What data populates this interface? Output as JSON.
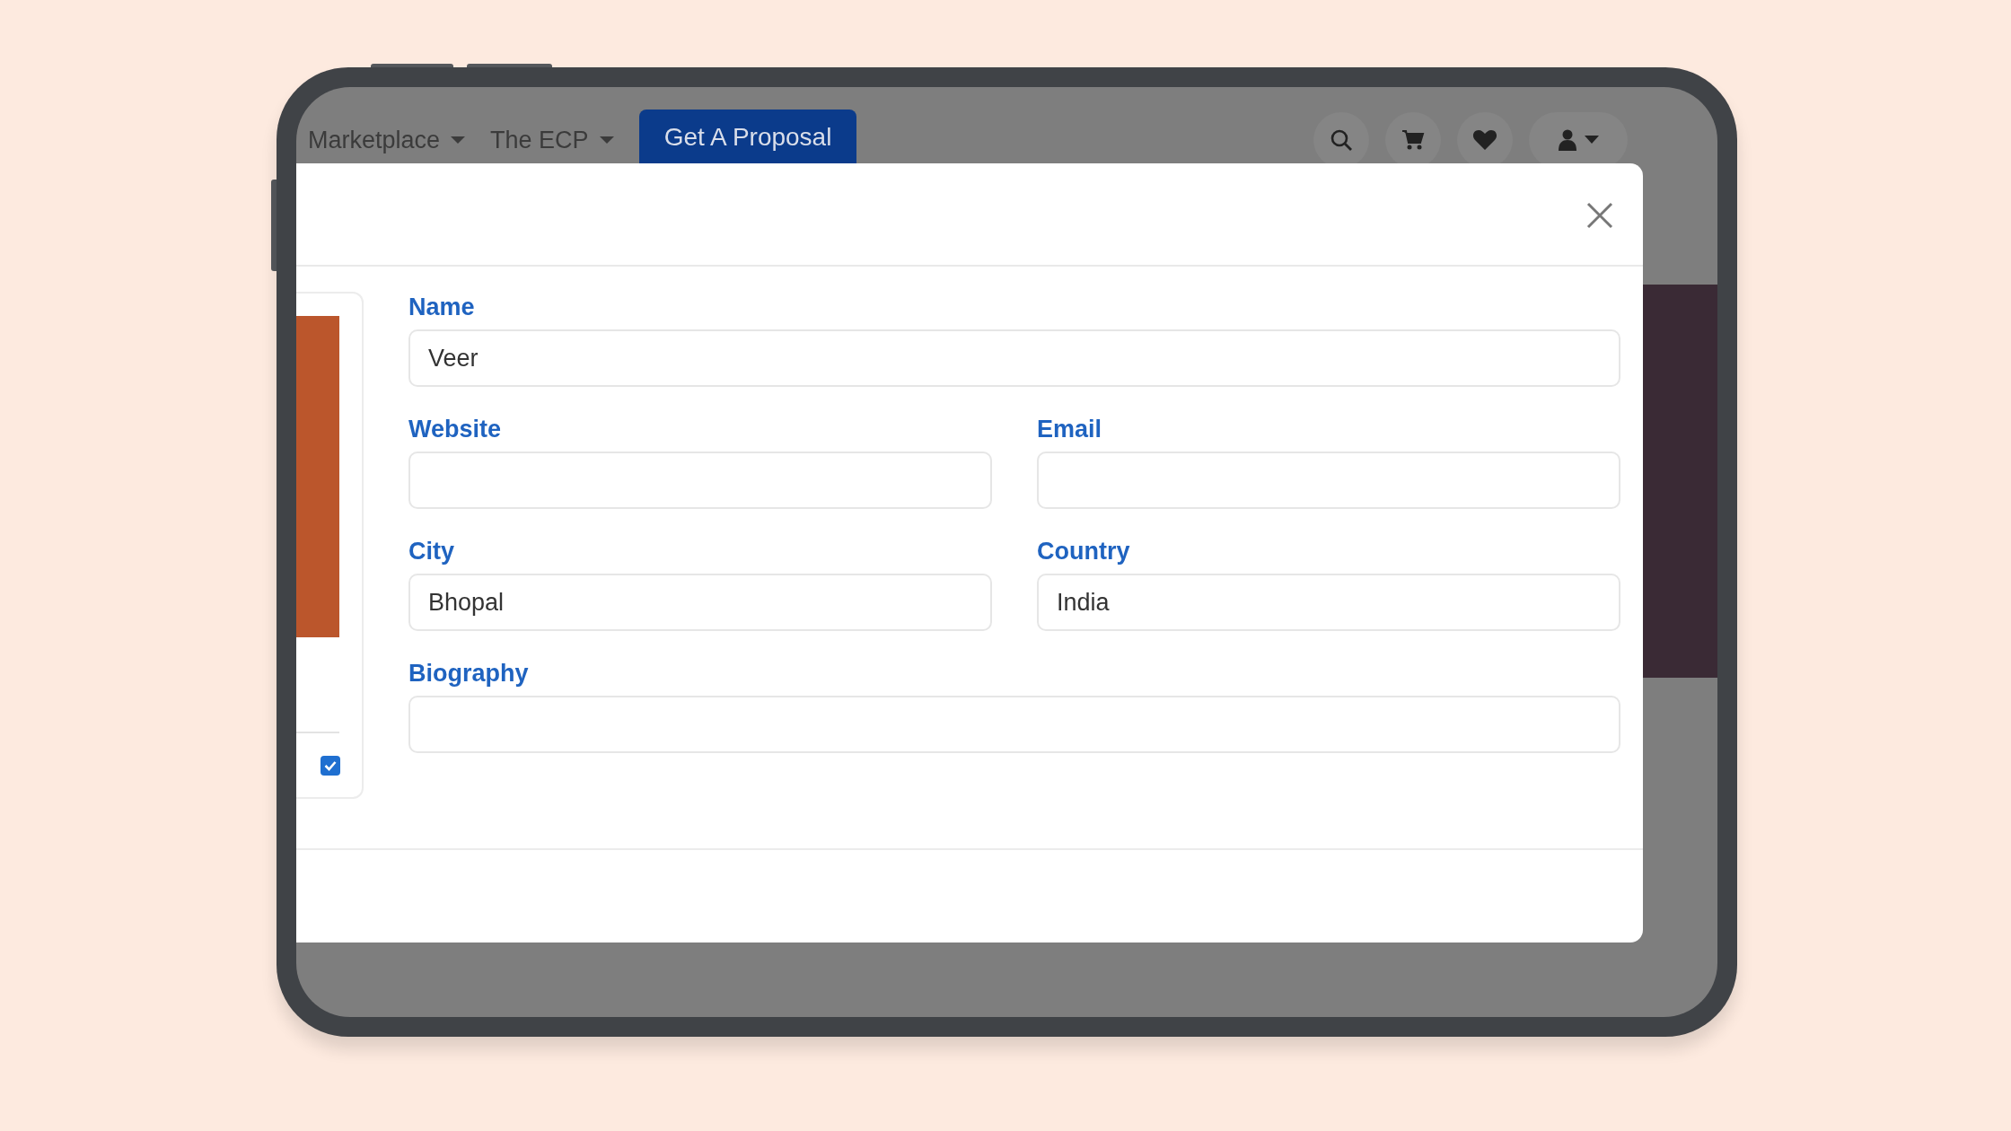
{
  "nav": {
    "menus": [
      {
        "label": "Marketplace"
      },
      {
        "label": "The ECP"
      }
    ],
    "cta": "Get A Proposal"
  },
  "side_card": {
    "checked": true
  },
  "form": {
    "fields": [
      {
        "label": "Name",
        "value": "Veer",
        "kind": "full"
      },
      {
        "label": "Website",
        "kind": "half"
      },
      {
        "label": "Email",
        "kind": "half"
      },
      {
        "label": "City",
        "value": "Bhopal",
        "kind": "half"
      },
      {
        "label": "Country",
        "value": "India",
        "kind": "half"
      },
      {
        "label": "Biography",
        "kind": "full"
      }
    ]
  }
}
